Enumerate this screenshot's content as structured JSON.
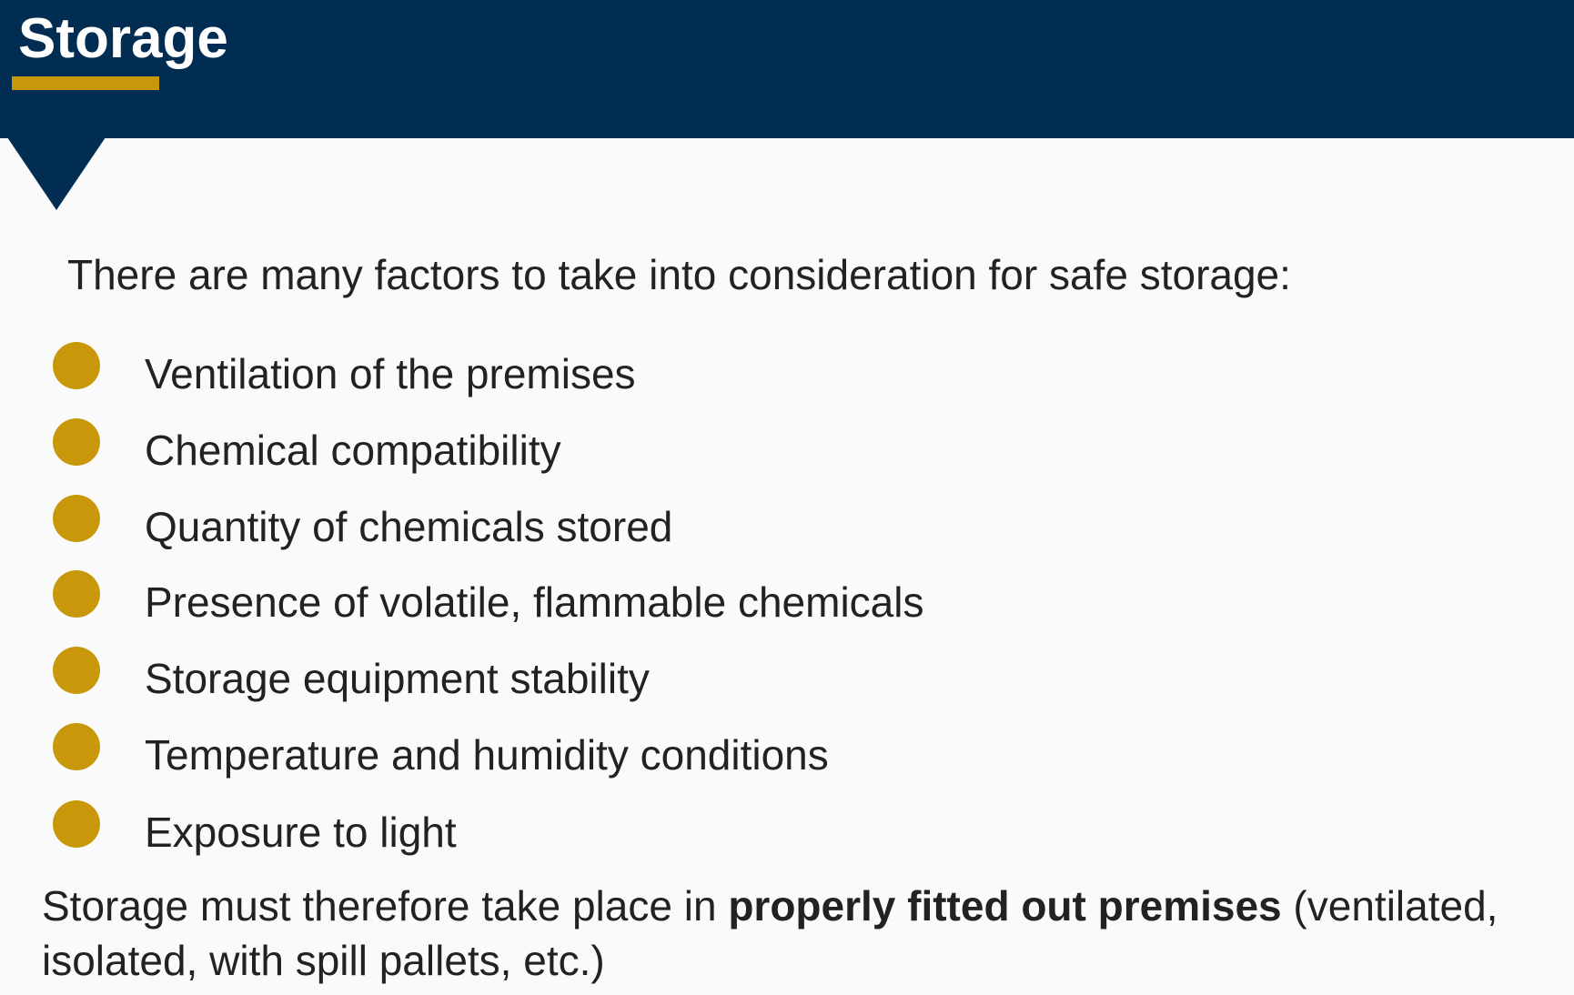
{
  "header": {
    "title": "Storage",
    "background_color": "#022d52",
    "accent_color": "#c9980a"
  },
  "main": {
    "intro": "There are many factors to take into consideration for safe storage:",
    "factors": [
      {
        "label": "Ventilation of the premises"
      },
      {
        "label": "Chemical compatibility"
      },
      {
        "label": "Quantity of chemicals stored"
      },
      {
        "label": "Presence of volatile, flammable chemicals"
      },
      {
        "label": "Storage equipment stability"
      },
      {
        "label": "Temperature and humidity conditions"
      },
      {
        "label": "Exposure to light"
      }
    ],
    "conclusion": {
      "before": "Storage must therefore take place in ",
      "emphasis": "properly fitted out premises",
      "after": " (ventilated, isolated, with spill pallets, etc.)"
    }
  }
}
